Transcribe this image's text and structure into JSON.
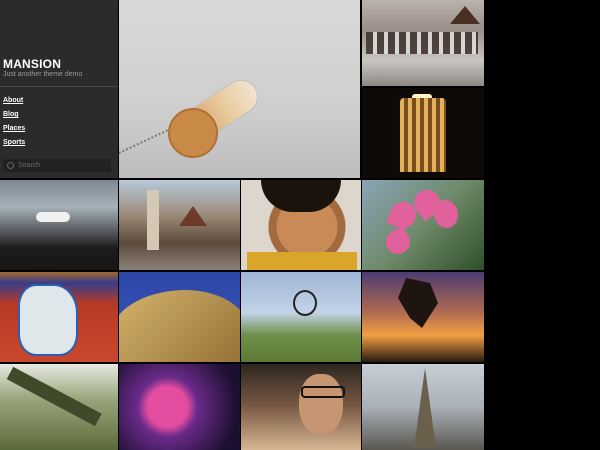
{
  "site": {
    "title": "MANSION",
    "tagline": "Just another theme demo"
  },
  "nav": {
    "items": [
      {
        "label": "About"
      },
      {
        "label": "Blog"
      },
      {
        "label": "Places"
      },
      {
        "label": "Sports"
      }
    ]
  },
  "search": {
    "placeholder": "Search",
    "icon": "search-icon"
  },
  "colors": {
    "sidebar_bg": "#2b2b2b",
    "page_bg": "#000000",
    "title": "#ffffff",
    "tagline": "#9a9a9a"
  }
}
